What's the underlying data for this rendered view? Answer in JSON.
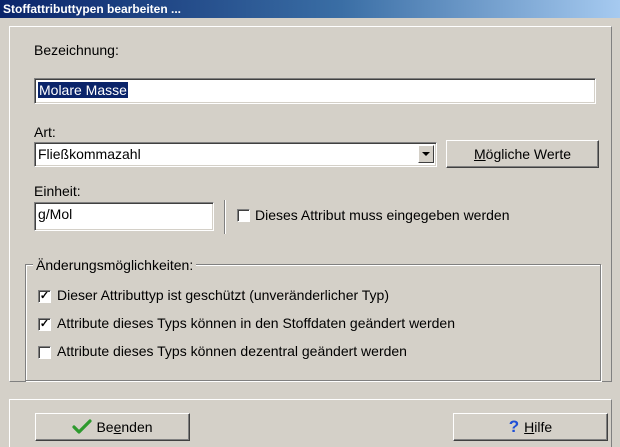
{
  "window": {
    "title": "Stoffattributtypen bearbeiten ..."
  },
  "form": {
    "bezeichnung_label": "Bezeichnung:",
    "bezeichnung_value": "Molare Masse",
    "art_label": "Art:",
    "art_value": "Fließkommazahl",
    "moegliche_werte_button_pre": "M",
    "moegliche_werte_button_post": "ögliche Werte",
    "einheit_label": "Einheit:",
    "einheit_value": "g/Mol",
    "muss_eingegeben_label": "Dieses Attribut muss eingegeben werden",
    "muss_eingegeben_checked": false
  },
  "group": {
    "title": "Änderungsmöglichkeiten:",
    "options": [
      {
        "label": "Dieser Attributtyp ist geschützt (unveränderlicher Typ)",
        "checked": true
      },
      {
        "label": "Attribute dieses Typs können in den Stoffdaten geändert werden",
        "checked": true
      },
      {
        "label": "Attribute dieses Typs können dezentral geändert werden",
        "checked": false
      }
    ]
  },
  "footer": {
    "beenden_pre": "Be",
    "beenden_mnemonic": "e",
    "beenden_post": "nden",
    "hilfe_mnemonic": "H",
    "hilfe_post": "ilfe"
  },
  "icons": {
    "beenden": "checkmark-icon",
    "hilfe": "question-mark-icon"
  },
  "colors": {
    "title_bar": "#0a246a",
    "face": "#d4d0c8",
    "selection": "#0a246a",
    "check_icon": "#2e9a2e",
    "help_icon": "#1f4fd6"
  }
}
